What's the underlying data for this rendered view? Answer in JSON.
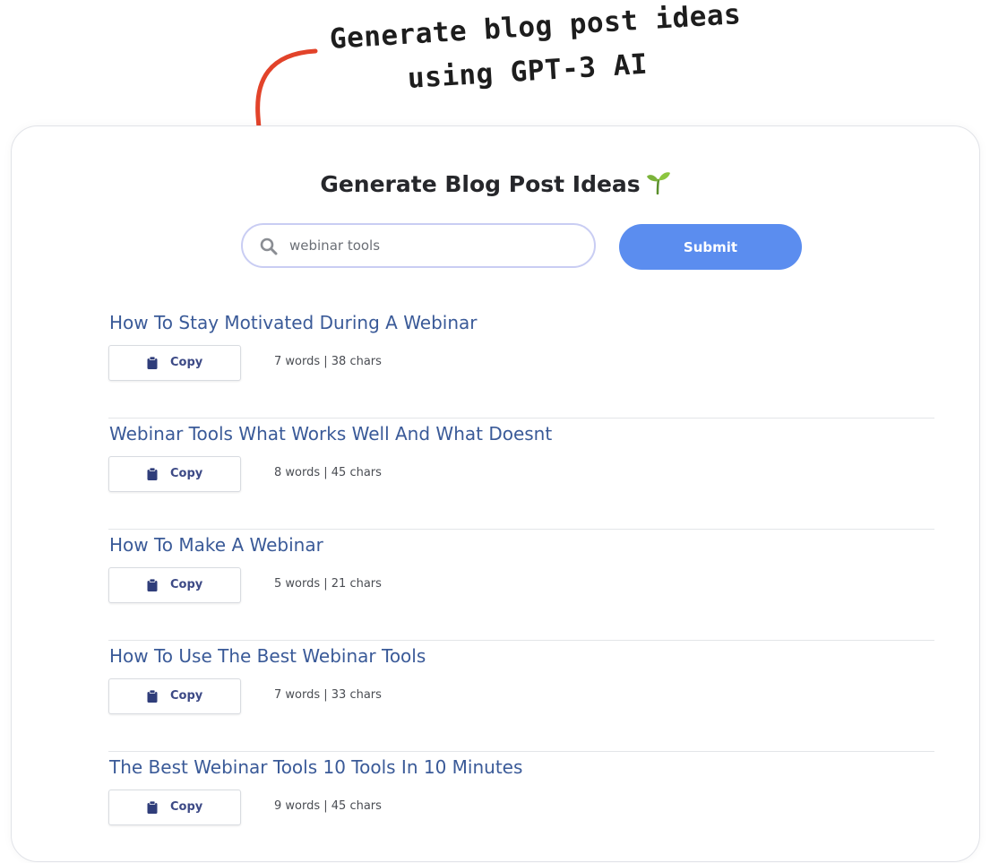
{
  "annotation": {
    "line1": "Generate blog post ideas",
    "line2": "using GPT-3 AI",
    "arrow_color": "#e2432a"
  },
  "page": {
    "title": "Generate Blog Post Ideas",
    "title_emoji_icon": "seedling-icon"
  },
  "search": {
    "value": "webinar tools",
    "icon": "search-icon"
  },
  "submit_label": "Submit",
  "colors": {
    "submit": "#5b8def",
    "result_title": "#3a5a98",
    "copy_text": "#3d4a86"
  },
  "results": [
    {
      "title": "How To Stay Motivated During A Webinar",
      "copy_label": "Copy",
      "stats": "7 words | 38 chars"
    },
    {
      "title": "Webinar Tools What Works Well And What Doesnt",
      "copy_label": "Copy",
      "stats": "8 words | 45 chars"
    },
    {
      "title": "How To Make A Webinar",
      "copy_label": "Copy",
      "stats": "5 words | 21 chars"
    },
    {
      "title": "How To Use The Best Webinar Tools",
      "copy_label": "Copy",
      "stats": "7 words | 33 chars"
    },
    {
      "title": "The Best Webinar Tools 10 Tools In 10 Minutes",
      "copy_label": "Copy",
      "stats": "9 words | 45 chars"
    }
  ]
}
